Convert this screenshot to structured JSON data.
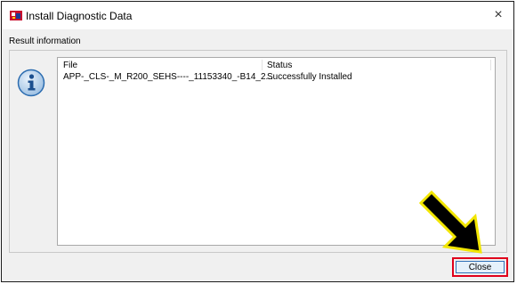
{
  "window": {
    "title": "Install Diagnostic Data",
    "close_glyph": "×"
  },
  "result": {
    "group_label": "Result information",
    "columns": {
      "file": "File",
      "status": "Status"
    },
    "rows": [
      {
        "file": "APP-_CLS-_M_R200_SEHS----_11153340_-B14_2...",
        "status": "Successfully Installed"
      }
    ]
  },
  "buttons": {
    "close": "Close"
  },
  "icons": {
    "app": "app-icon",
    "info": "info-icon",
    "arrow": "pointer-arrow"
  },
  "colors": {
    "highlight_border": "#e0001b",
    "arrow_fill": "#000000",
    "arrow_outline": "#f2e600",
    "info_blue": "#2b6cb0"
  }
}
